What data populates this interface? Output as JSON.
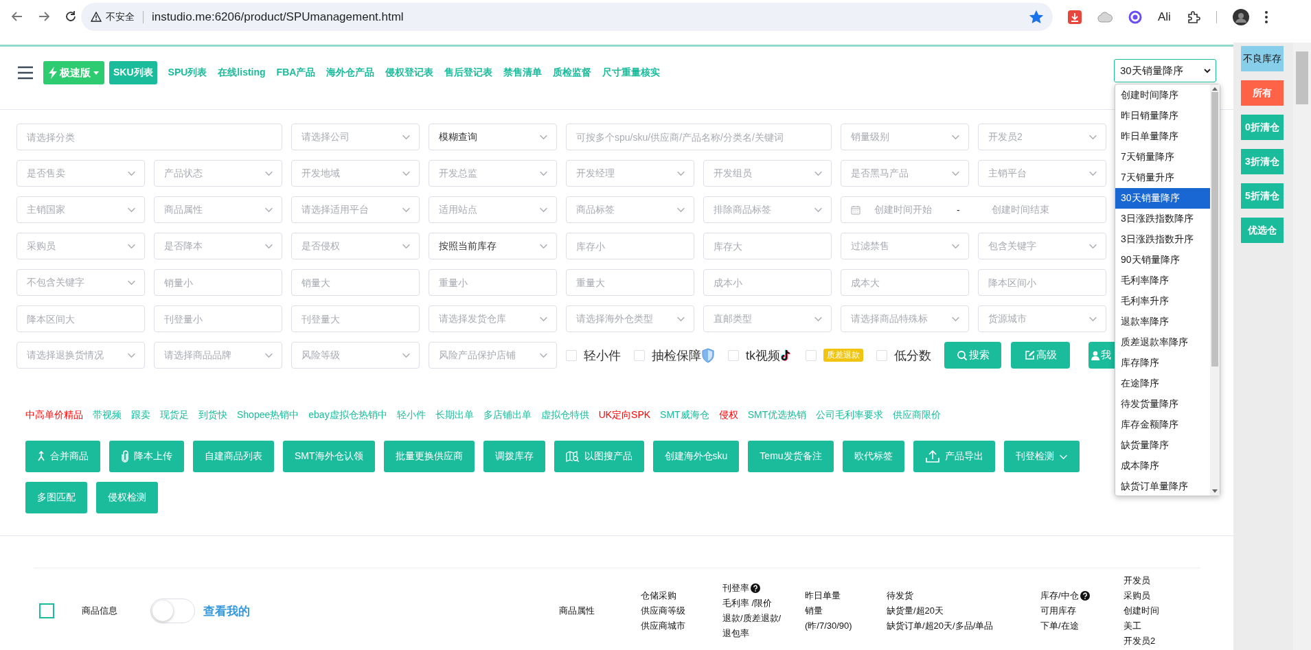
{
  "browser": {
    "security_label": "不安全",
    "url": "instudio.me:6206/product/SPUmanagement.html",
    "bookmarked": true,
    "extension_label": "Ali"
  },
  "nav": {
    "speed_label": "极速版",
    "tabs": [
      {
        "label": "SKU列表",
        "selected": true
      },
      {
        "label": "SPU列表",
        "selected": false
      },
      {
        "label": "在线listing",
        "selected": false
      },
      {
        "label": "FBA产品",
        "selected": false
      },
      {
        "label": "海外仓产品",
        "selected": false
      },
      {
        "label": "侵权登记表",
        "selected": false
      },
      {
        "label": "售后登记表",
        "selected": false
      },
      {
        "label": "禁售清单",
        "selected": false
      },
      {
        "label": "质检监督",
        "selected": false
      },
      {
        "label": "尺寸重量核实",
        "selected": false
      }
    ]
  },
  "sort": {
    "value": "30天销量降序",
    "expanded": true,
    "options": [
      {
        "label": "创建时间降序",
        "selected": false
      },
      {
        "label": "昨日销量降序",
        "selected": false
      },
      {
        "label": "昨日单量降序",
        "selected": false
      },
      {
        "label": "7天销量降序",
        "selected": false
      },
      {
        "label": "7天销量升序",
        "selected": false
      },
      {
        "label": "30天销量降序",
        "selected": true
      },
      {
        "label": "3日涨跌指数降序",
        "selected": false
      },
      {
        "label": "3日涨跌指数升序",
        "selected": false
      },
      {
        "label": "90天销量降序",
        "selected": false
      },
      {
        "label": "毛利率降序",
        "selected": false
      },
      {
        "label": "毛利率升序",
        "selected": false
      },
      {
        "label": "退款率降序",
        "selected": false
      },
      {
        "label": "质差退款率降序",
        "selected": false
      },
      {
        "label": "库存降序",
        "selected": false
      },
      {
        "label": "在途降序",
        "selected": false
      },
      {
        "label": "待发货量降序",
        "selected": false
      },
      {
        "label": "库存金额降序",
        "selected": false
      },
      {
        "label": "缺货量降序",
        "selected": false
      },
      {
        "label": "成本降序",
        "selected": false
      },
      {
        "label": "缺货订单量降序",
        "selected": false
      }
    ]
  },
  "filters": [
    [
      {
        "kind": "wide-input",
        "placeholder": "请选择分类"
      },
      {
        "kind": "select",
        "placeholder": "请选择公司"
      },
      {
        "kind": "select",
        "value": "模糊查询"
      },
      {
        "kind": "wide-input",
        "placeholder": "可按多个spu/sku/供应商/产品名称/分类名/关键词"
      },
      {
        "kind": "select",
        "placeholder": "销量级别"
      },
      {
        "kind": "select",
        "placeholder": "开发员2"
      }
    ],
    [
      {
        "kind": "select",
        "placeholder": "是否售卖"
      },
      {
        "kind": "select",
        "placeholder": "产品状态"
      },
      {
        "kind": "select",
        "placeholder": "开发地域"
      },
      {
        "kind": "select",
        "placeholder": "开发总监"
      },
      {
        "kind": "select",
        "placeholder": "开发经理"
      },
      {
        "kind": "select",
        "placeholder": "开发组员"
      },
      {
        "kind": "select",
        "placeholder": "是否黑马产品"
      },
      {
        "kind": "select",
        "placeholder": "主销平台"
      }
    ],
    [
      {
        "kind": "select",
        "placeholder": "主销国家"
      },
      {
        "kind": "select",
        "placeholder": "商品属性"
      },
      {
        "kind": "select",
        "placeholder": "请选择适用平台"
      },
      {
        "kind": "select",
        "placeholder": "适用站点"
      },
      {
        "kind": "select",
        "placeholder": "商品标签"
      },
      {
        "kind": "select",
        "placeholder": "排除商品标签"
      },
      {
        "kind": "date-range",
        "start": "创建时间开始",
        "separator": "-",
        "end": "创建时间结束"
      }
    ],
    [
      {
        "kind": "select",
        "placeholder": "采购员"
      },
      {
        "kind": "select",
        "placeholder": "是否降本"
      },
      {
        "kind": "select",
        "placeholder": "是否侵权"
      },
      {
        "kind": "select",
        "value": "按照当前库存"
      },
      {
        "kind": "input",
        "placeholder": "库存小"
      },
      {
        "kind": "input",
        "placeholder": "库存大"
      },
      {
        "kind": "select",
        "placeholder": "过滤禁售"
      },
      {
        "kind": "select",
        "placeholder": "包含关键字"
      }
    ],
    [
      {
        "kind": "select",
        "placeholder": "不包含关键字"
      },
      {
        "kind": "input",
        "placeholder": "销量小"
      },
      {
        "kind": "input",
        "placeholder": "销量大"
      },
      {
        "kind": "input",
        "placeholder": "重量小"
      },
      {
        "kind": "input",
        "placeholder": "重量大"
      },
      {
        "kind": "input",
        "placeholder": "成本小"
      },
      {
        "kind": "input",
        "placeholder": "成本大"
      },
      {
        "kind": "input",
        "placeholder": "降本区间小"
      }
    ],
    [
      {
        "kind": "input",
        "placeholder": "降本区间大"
      },
      {
        "kind": "input",
        "placeholder": "刊登量小"
      },
      {
        "kind": "input",
        "placeholder": "刊登量大"
      },
      {
        "kind": "select",
        "placeholder": "请选择发货仓库"
      },
      {
        "kind": "select",
        "placeholder": "请选择海外仓类型"
      },
      {
        "kind": "select",
        "placeholder": "直邮类型"
      },
      {
        "kind": "select",
        "placeholder": "请选择商品特殊标"
      },
      {
        "kind": "select",
        "placeholder": "货源城市"
      }
    ],
    [
      {
        "kind": "select",
        "placeholder": "请选择退换货情况"
      },
      {
        "kind": "select",
        "placeholder": "请选择商品品牌"
      },
      {
        "kind": "select",
        "placeholder": "风险等级"
      },
      {
        "kind": "select",
        "placeholder": "风险产品保护店铺"
      }
    ]
  ],
  "toggles": [
    {
      "label": "轻小件",
      "checked": false,
      "kind": "plain"
    },
    {
      "label": "抽检保障",
      "checked": false,
      "kind": "shield"
    },
    {
      "label": "tk视频",
      "checked": false,
      "kind": "tiktok"
    },
    {
      "label": "质差退款",
      "checked": false,
      "kind": "badge"
    },
    {
      "label": "低分数",
      "checked": false,
      "kind": "plain"
    }
  ],
  "actions": [
    {
      "label": "搜索",
      "kind": "search"
    },
    {
      "label": "高级",
      "kind": "edit"
    },
    {
      "label": "我",
      "kind": "user"
    }
  ],
  "quick_tags": [
    {
      "label": "中高单价精品",
      "color": "#ff0000"
    },
    {
      "label": "带视频",
      "color": "#1abc9c"
    },
    {
      "label": "跟卖",
      "color": "#1abc9c"
    },
    {
      "label": "现货足",
      "color": "#1abc9c"
    },
    {
      "label": "到货快",
      "color": "#1abc9c"
    },
    {
      "label": "Shopee热销中",
      "color": "#1abc9c"
    },
    {
      "label": "ebay虚拟仓热销中",
      "color": "#1abc9c"
    },
    {
      "label": "轻小件",
      "color": "#1abc9c"
    },
    {
      "label": "长期出单",
      "color": "#1abc9c"
    },
    {
      "label": "多店铺出单",
      "color": "#1abc9c"
    },
    {
      "label": "虚拟仓特供",
      "color": "#1abc9c"
    },
    {
      "label": "UK定向SPK",
      "color": "#ff0000"
    },
    {
      "label": "SMT威海仓",
      "color": "#1abc9c"
    },
    {
      "label": "侵权",
      "color": "#ff0000"
    },
    {
      "label": "SMT优选热销",
      "color": "#1abc9c"
    },
    {
      "label": "公司毛利率要求",
      "color": "#1abc9c"
    },
    {
      "label": "供应商限价",
      "color": "#1abc9c"
    }
  ],
  "tools": [
    [
      {
        "label": "合并商品",
        "kind": "merge"
      },
      {
        "label": "降本上传",
        "kind": "clip"
      },
      {
        "label": "自建商品列表",
        "kind": "plain"
      },
      {
        "label": "SMT海外仓认领",
        "kind": "plain"
      },
      {
        "label": "批量更换供应商",
        "kind": "plain"
      },
      {
        "label": "调拨库存",
        "kind": "plain"
      },
      {
        "label": "以图搜产品",
        "kind": "map"
      },
      {
        "label": "创建海外仓sku",
        "kind": "plain"
      },
      {
        "label": "Temu发货备注",
        "kind": "plain"
      },
      {
        "label": "欧代标签",
        "kind": "plain"
      },
      {
        "label": "产品导出",
        "kind": "upload"
      },
      {
        "label": "刊登检测",
        "kind": "menu"
      }
    ],
    [
      {
        "label": "多图匹配",
        "kind": "plain"
      },
      {
        "label": "侵权检测",
        "kind": "plain"
      }
    ]
  ],
  "side_buttons": [
    {
      "label": "不良库存",
      "color": "#87ceeb"
    },
    {
      "label": "所有",
      "color": "#ff6347"
    },
    {
      "label": "0折清仓",
      "color": "#1abc9c"
    },
    {
      "label": "3折清仓",
      "color": "#1abc9c"
    },
    {
      "label": "5折清仓",
      "color": "#1abc9c"
    },
    {
      "label": "优选仓",
      "color": "#1abc9c"
    }
  ],
  "table": {
    "select_all_checked": false,
    "view_mine": {
      "label": "查看我的",
      "on": false
    },
    "columns": [
      {
        "lines": [
          {
            "text": "商品信息",
            "help": false
          }
        ]
      },
      {
        "lines": [
          {
            "text": "商品属性",
            "help": false
          }
        ]
      },
      {
        "lines": [
          {
            "text": "仓储采购",
            "help": false
          },
          {
            "text": "供应商等级",
            "help": false
          },
          {
            "text": "供应商城市",
            "help": false
          }
        ]
      },
      {
        "lines": [
          {
            "text": "刊登率",
            "help": true
          },
          {
            "text": "毛利率 /限价",
            "help": false
          },
          {
            "text": "退款/质差退款/",
            "help": false
          },
          {
            "text": "退包率",
            "help": false
          }
        ]
      },
      {
        "lines": [
          {
            "text": "昨日单量",
            "help": false
          },
          {
            "text": "销量",
            "help": false
          },
          {
            "text": "(昨/7/30/90)",
            "help": false
          }
        ]
      },
      {
        "lines": [
          {
            "text": "待发货",
            "help": false
          },
          {
            "text": "缺货量/超20天",
            "help": false
          },
          {
            "text": "缺货订单/超20天/多品/单品",
            "help": false
          }
        ]
      },
      {
        "lines": [
          {
            "text": "库存/中仓",
            "help": true
          },
          {
            "text": "可用库存",
            "help": false
          },
          {
            "text": "下单/在途",
            "help": false
          }
        ]
      },
      {
        "lines": [
          {
            "text": "开发员",
            "help": false
          },
          {
            "text": "采购员",
            "help": false
          },
          {
            "text": "创建时间",
            "help": false
          },
          {
            "text": "美工",
            "help": false
          },
          {
            "text": "开发员2",
            "help": false
          }
        ]
      }
    ]
  }
}
